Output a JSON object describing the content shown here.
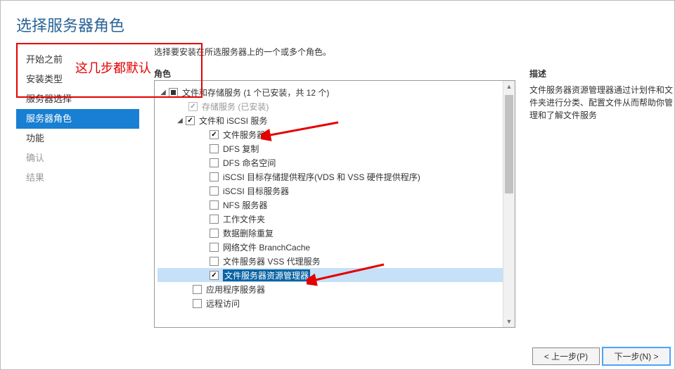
{
  "title": "选择服务器角色",
  "nav": [
    {
      "label": "开始之前",
      "state": "normal"
    },
    {
      "label": "安装类型",
      "state": "normal"
    },
    {
      "label": "服务器选择",
      "state": "normal"
    },
    {
      "label": "服务器角色",
      "state": "selected"
    },
    {
      "label": "功能",
      "state": "normal"
    },
    {
      "label": "确认",
      "state": "disabled"
    },
    {
      "label": "结果",
      "state": "disabled"
    }
  ],
  "instruction": "选择要安装在所选服务器上的一个或多个角色。",
  "tree_header": "角色",
  "tree": {
    "top": {
      "label": "文件和存储服务 (1 个已安装，共 12 个)",
      "indet": true
    },
    "storage": {
      "label": "存储服务 (已安装)",
      "checked": true,
      "disabled": true
    },
    "file_iscsi": {
      "label": "文件和 iSCSI 服务",
      "checked": true
    },
    "children": [
      {
        "label": "文件服务器",
        "checked": true
      },
      {
        "label": "DFS 复制",
        "checked": false
      },
      {
        "label": "DFS 命名空间",
        "checked": false
      },
      {
        "label": "iSCSI 目标存储提供程序(VDS 和 VSS 硬件提供程序)",
        "checked": false
      },
      {
        "label": "iSCSI 目标服务器",
        "checked": false
      },
      {
        "label": "NFS 服务器",
        "checked": false
      },
      {
        "label": "工作文件夹",
        "checked": false
      },
      {
        "label": "数据删除重复",
        "checked": false
      },
      {
        "label": "网络文件 BranchCache",
        "checked": false
      },
      {
        "label": "文件服务器 VSS 代理服务",
        "checked": false
      },
      {
        "label": "文件服务器资源管理器",
        "checked": true,
        "highlight": true
      }
    ],
    "siblings": [
      {
        "label": "应用程序服务器",
        "checked": false
      },
      {
        "label": "远程访问",
        "checked": false
      }
    ]
  },
  "desc": {
    "title": "描述",
    "body": "文件服务器资源管理器通过计划件和文件夹进行分类、配置文件从而帮助你管理和了解文件服务"
  },
  "buttons": {
    "prev": "< 上一步(P)",
    "next": "下一步(N) >"
  },
  "annotation_text": "这几步都默认",
  "colors": {
    "accent": "#197fd2",
    "annotation": "#e40000",
    "highlight": "#0a64a4"
  }
}
